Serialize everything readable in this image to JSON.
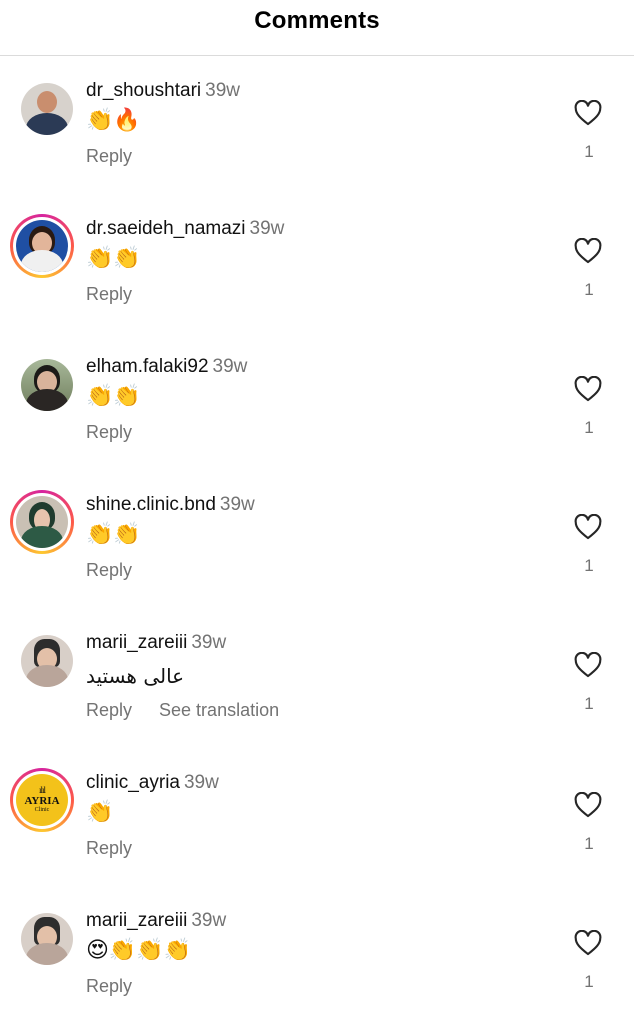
{
  "header": {
    "title": "Comments"
  },
  "comments": [
    {
      "username": "dr_shoushtari",
      "time": "39w",
      "text": "👏🔥",
      "reply": "Reply",
      "likes": "1",
      "ring": false
    },
    {
      "username": "dr.saeideh_namazi",
      "time": "39w",
      "text": "👏👏",
      "reply": "Reply",
      "likes": "1",
      "ring": true
    },
    {
      "username": "elham.falaki92",
      "time": "39w",
      "text": "👏👏",
      "reply": "Reply",
      "likes": "1",
      "ring": false
    },
    {
      "username": "shine.clinic.bnd",
      "time": "39w",
      "text": "👏👏",
      "reply": "Reply",
      "likes": "1",
      "ring": true
    },
    {
      "username": "marii_zareiii",
      "time": "39w",
      "text": "عالی هستید",
      "reply": "Reply",
      "see_translation": "See translation",
      "likes": "1",
      "ring": false
    },
    {
      "username": "clinic_ayria",
      "time": "39w",
      "text": "👏",
      "reply": "Reply",
      "likes": "1",
      "ring": true,
      "logo": {
        "name": "AYRIA",
        "sub": "Clinic"
      }
    },
    {
      "username": "marii_zareiii",
      "time": "39w",
      "text": "😍👏👏👏",
      "reply": "Reply",
      "likes": "1",
      "ring": false
    }
  ],
  "icons": {
    "like": "heart-outline-icon"
  },
  "colors": {
    "secondary_text": "#737373",
    "story_ring_start": "#d6249f",
    "story_ring_end": "#fdc830",
    "divider": "#dbdbdb"
  }
}
